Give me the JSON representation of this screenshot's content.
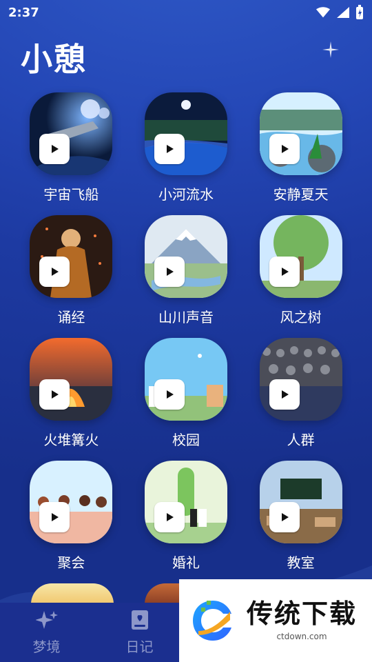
{
  "status": {
    "time": "2:37"
  },
  "title": "小憩",
  "items": [
    {
      "label": "宇宙飞船",
      "art": "space"
    },
    {
      "label": "小河流水",
      "art": "river"
    },
    {
      "label": "安静夏天",
      "art": "summer"
    },
    {
      "label": "诵经",
      "art": "monk"
    },
    {
      "label": "山川声音",
      "art": "mountain"
    },
    {
      "label": "风之树",
      "art": "tree"
    },
    {
      "label": "火堆篝火",
      "art": "fire"
    },
    {
      "label": "校园",
      "art": "campus"
    },
    {
      "label": "人群",
      "art": "crowd"
    },
    {
      "label": "聚会",
      "art": "party"
    },
    {
      "label": "婚礼",
      "art": "wedding"
    },
    {
      "label": "教室",
      "art": "classroom"
    }
  ],
  "nav": [
    {
      "label": "梦境",
      "icon": "sparkle-icon"
    },
    {
      "label": "日记",
      "icon": "diary-icon"
    }
  ],
  "watermark": {
    "title": "传统下载",
    "site": "ctdown.com"
  }
}
